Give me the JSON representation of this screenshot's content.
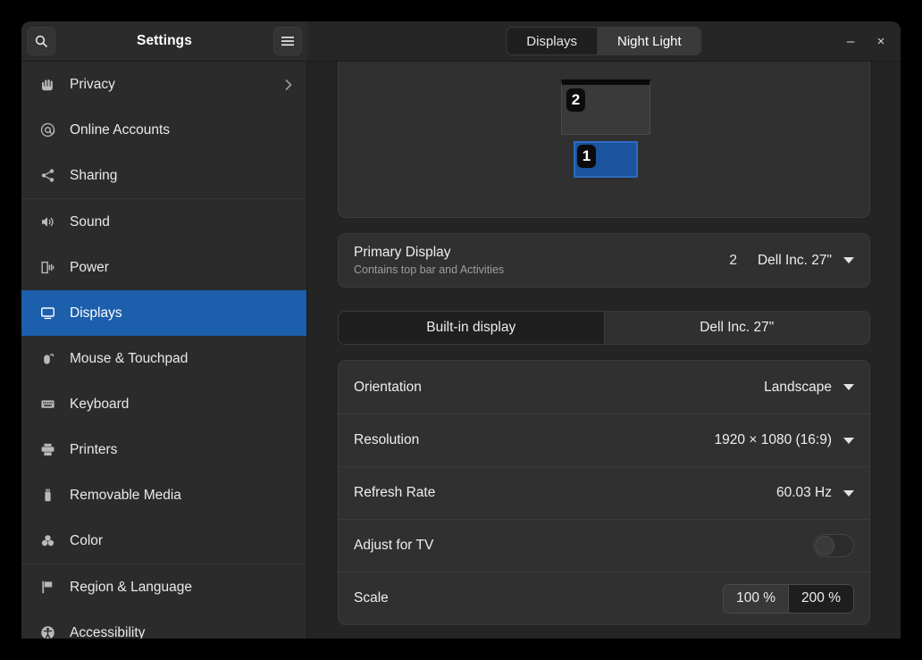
{
  "window": {
    "app_title": "Settings",
    "search_icon": "search-icon",
    "menu_icon": "hamburger-menu-icon",
    "minimize_label": "–",
    "close_label": "×",
    "accent_color": "#1c5fad",
    "panel_color": "#303030"
  },
  "view_tabs": [
    {
      "label": "Displays",
      "active": false
    },
    {
      "label": "Night Light",
      "active": true
    }
  ],
  "sidebar": {
    "items": [
      {
        "label": "Privacy",
        "icon": "hand-icon",
        "selected": false,
        "chevron": true,
        "separator_after": false
      },
      {
        "label": "Online Accounts",
        "icon": "at-sign-icon",
        "selected": false,
        "chevron": false,
        "separator_after": false
      },
      {
        "label": "Sharing",
        "icon": "share-nodes-icon",
        "selected": false,
        "chevron": false,
        "separator_after": true
      },
      {
        "label": "Sound",
        "icon": "speaker-icon",
        "selected": false,
        "chevron": false,
        "separator_after": false
      },
      {
        "label": "Power",
        "icon": "battery-plug-icon",
        "selected": false,
        "chevron": false,
        "separator_after": false
      },
      {
        "label": "Displays",
        "icon": "monitor-icon",
        "selected": true,
        "chevron": false,
        "separator_after": false
      },
      {
        "label": "Mouse & Touchpad",
        "icon": "mouse-icon",
        "selected": false,
        "chevron": false,
        "separator_after": false
      },
      {
        "label": "Keyboard",
        "icon": "keyboard-icon",
        "selected": false,
        "chevron": false,
        "separator_after": false
      },
      {
        "label": "Printers",
        "icon": "printer-icon",
        "selected": false,
        "chevron": false,
        "separator_after": false
      },
      {
        "label": "Removable Media",
        "icon": "usb-drive-icon",
        "selected": false,
        "chevron": false,
        "separator_after": false
      },
      {
        "label": "Color",
        "icon": "color-circles-icon",
        "selected": false,
        "chevron": false,
        "separator_after": true
      },
      {
        "label": "Region & Language",
        "icon": "flag-icon",
        "selected": false,
        "chevron": false,
        "separator_after": false
      },
      {
        "label": "Accessibility",
        "icon": "accessibility-icon",
        "selected": false,
        "chevron": false,
        "separator_after": false
      }
    ]
  },
  "main": {
    "arrangement": {
      "monitors": [
        {
          "number": "2",
          "selected": false
        },
        {
          "number": "1",
          "selected": true
        }
      ]
    },
    "primary_display": {
      "title": "Primary Display",
      "subtitle": "Contains top bar and Activities",
      "monitor_number": "2",
      "value": "Dell Inc. 27\""
    },
    "display_chooser": [
      {
        "label": "Built-in display",
        "active": true
      },
      {
        "label": "Dell Inc. 27\"",
        "active": false
      }
    ],
    "settings": {
      "orientation": {
        "label": "Orientation",
        "value": "Landscape"
      },
      "resolution": {
        "label": "Resolution",
        "value": "1920 × 1080 (16:9)"
      },
      "refresh_rate": {
        "label": "Refresh Rate",
        "value": "60.03 Hz"
      },
      "adjust_for_tv": {
        "label": "Adjust for TV",
        "enabled": false
      },
      "scale": {
        "label": "Scale",
        "options": [
          {
            "label": "100 %",
            "active": true
          },
          {
            "label": "200 %",
            "active": false
          }
        ]
      }
    }
  }
}
